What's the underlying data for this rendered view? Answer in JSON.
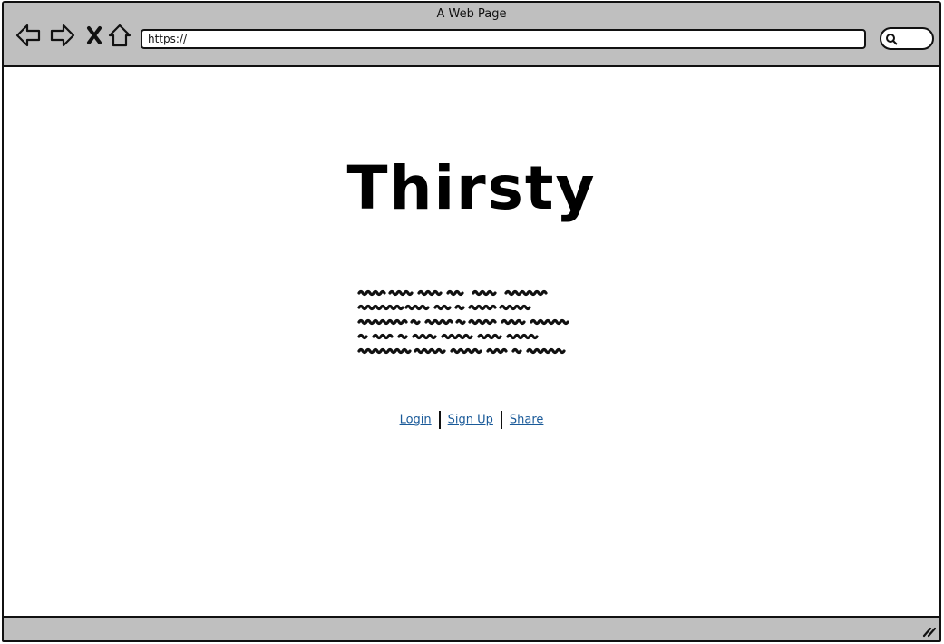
{
  "window": {
    "title": "A Web Page"
  },
  "toolbar": {
    "back_icon": "back-arrow-icon",
    "forward_icon": "forward-arrow-icon",
    "stop_icon": "close-x-icon",
    "home_icon": "home-icon",
    "url": "https://",
    "search_icon": "search-icon"
  },
  "page": {
    "heading": "Thirsty",
    "body_placeholder": "scribbled placeholder text (5 lines)",
    "links": {
      "login": "Login",
      "signup": "Sign Up",
      "share": "Share"
    }
  },
  "colors": {
    "chrome": "#bfbfbf",
    "link": "#1a5a99",
    "ink": "#111111"
  }
}
